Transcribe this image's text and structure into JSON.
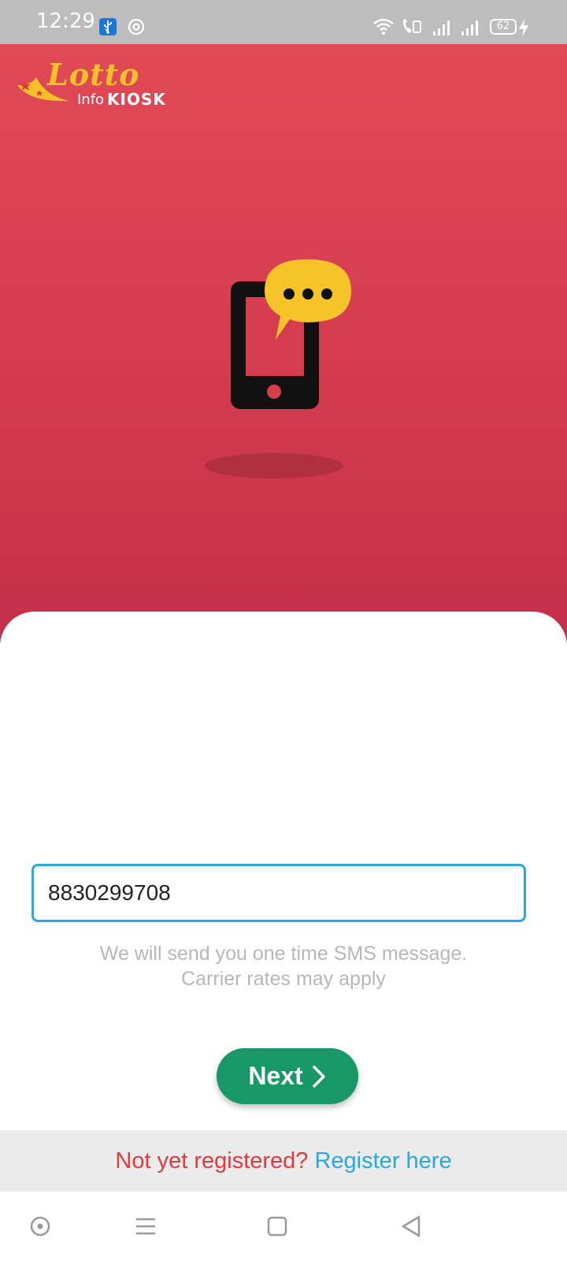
{
  "status_bar": {
    "time": "12:29",
    "battery": "62",
    "icons": [
      "usb-icon",
      "at-icon",
      "wifi-icon",
      "volte-call-icon",
      "signal-icon",
      "signal-icon",
      "battery-icon",
      "charging-icon"
    ]
  },
  "logo": {
    "brand": "Lotto",
    "sub_left": "Info",
    "sub_right": "KIOSK"
  },
  "illustration": {
    "icon": "phone-message-icon",
    "colors": {
      "phone": "#111111",
      "bubble": "#f6c428",
      "shadow": "#9e2a3a"
    }
  },
  "form": {
    "phone_value": "8830299708",
    "note_line1": "We will send you one time SMS message.",
    "note_line2": "Carrier rates may apply",
    "next_label": "Next"
  },
  "footer": {
    "prompt": "Not yet registered?",
    "link": "Register here"
  },
  "nav": {
    "icons": [
      "home-circle-icon",
      "recents-menu-icon",
      "home-square-icon",
      "back-triangle-icon"
    ]
  },
  "colors": {
    "hero_top": "#e04a56",
    "hero_bottom": "#c42f4a",
    "accent": "#29a9e0",
    "button": "#189767",
    "prompt_red": "#e03a3e"
  }
}
